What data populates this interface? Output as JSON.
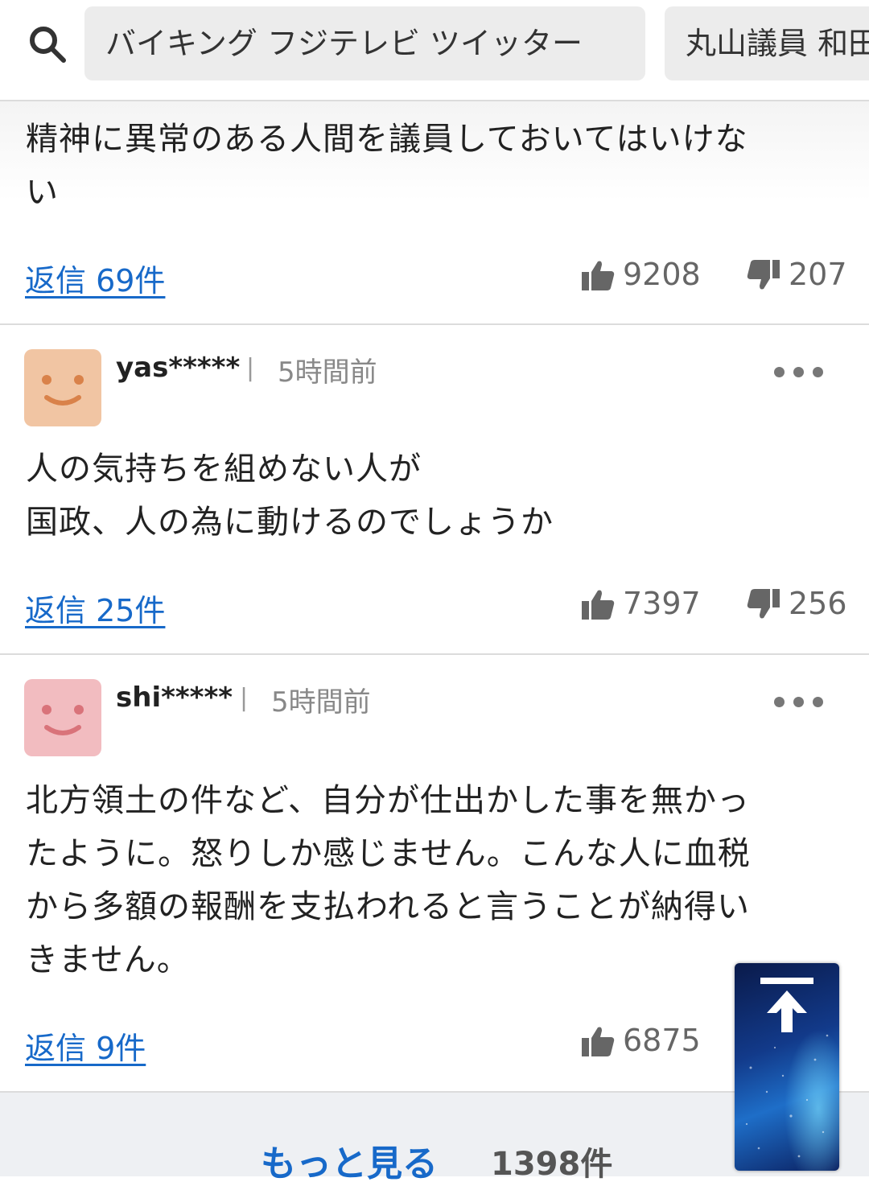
{
  "search": {
    "chips": [
      "バイキング フジテレビ ツイッター",
      "丸山議員 和田"
    ]
  },
  "comments": [
    {
      "text_lines": [
        "精神に異常のある人間を議員しておいてはいけな",
        "い"
      ],
      "reply_label": "返信 69件",
      "likes": "9208",
      "dislikes": "207"
    },
    {
      "username": "yas*****",
      "separator": "|",
      "time": "5時間前",
      "avatar_color": "#f1c5a3",
      "text_lines": [
        "人の気持ちを組めない人が",
        "国政、人の為に動けるのでしょうか"
      ],
      "reply_label": "返信 25件",
      "likes": "7397",
      "dislikes": "256"
    },
    {
      "username": "shi*****",
      "separator": "|",
      "time": "5時間前",
      "avatar_color": "#f2bcc0",
      "text_lines": [
        "北方領土の件など、自分が仕出かした事を無かっ",
        "たように。怒りしか感じません。こんな人に血税",
        "から多額の報酬を支払われると言うことが納得い",
        "きません。"
      ],
      "reply_label": "返信 9件",
      "likes": "6875"
    }
  ],
  "footer": {
    "more_label": "もっと見る",
    "total_count": "1398件"
  },
  "colors": {
    "link": "#1769c9",
    "muted": "#888888"
  },
  "icons": [
    "search-icon",
    "thumbs-up-icon",
    "thumbs-down-icon",
    "more-dots-icon",
    "arrow-up-icon"
  ]
}
